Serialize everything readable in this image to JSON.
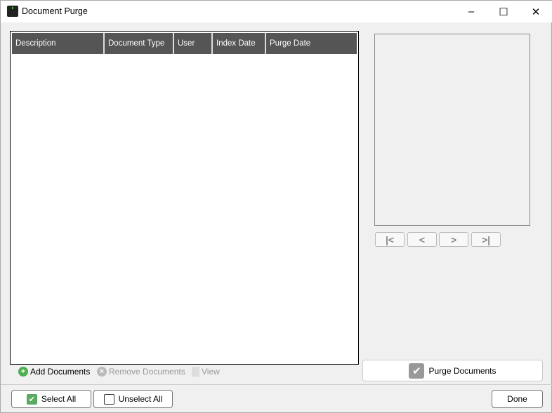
{
  "window": {
    "title": "Document Purge",
    "minimize": "–",
    "maximize": "☐",
    "close": "✕"
  },
  "grid": {
    "columns": [
      "Description",
      "Document Type",
      "User",
      "Index Date",
      "Purge Date"
    ],
    "rows": []
  },
  "navigation": {
    "first": "|<",
    "prev": "<",
    "next": ">",
    "last": ">|"
  },
  "toolbar": {
    "add": "Add Documents",
    "remove": "Remove Documents",
    "view": "View"
  },
  "buttons": {
    "purge": "Purge Documents",
    "select_all": "Select All",
    "unselect_all": "Unselect All",
    "done": "Done"
  },
  "colors": {
    "header_bg": "#555555",
    "add_icon": "#4caf50",
    "check_green": "#5aab61"
  }
}
